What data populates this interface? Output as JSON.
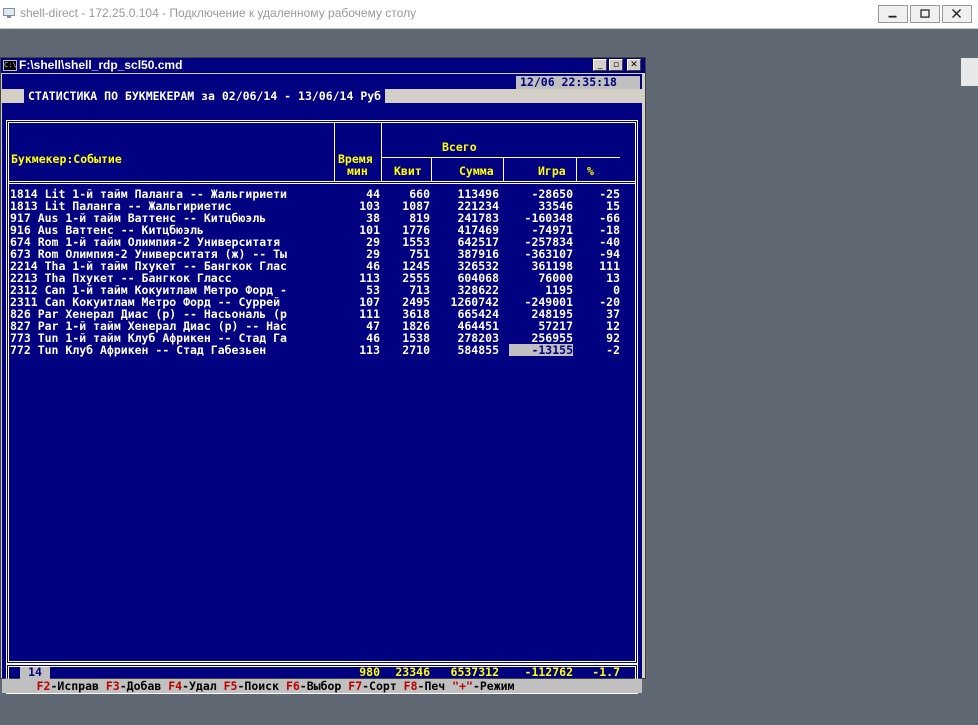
{
  "rdp_window": {
    "title": "shell-direct - 172.25.0.104 - Подключение к удаленному рабочему столу"
  },
  "console_window": {
    "title": "F:\\shell\\shell_rdp_scl50.cmd",
    "icon_text": "C:\\"
  },
  "screen": {
    "datetime": "12/06  22:35:18",
    "title": "СТАТИСТИКА ПО БУКМЕКЕРАМ за 02/06/14 - 13/06/14 Руб",
    "headers": {
      "event": "Букмекер:Событие",
      "time_line1": "Время",
      "time_line2": "мин",
      "total": "Всего",
      "kvit": "Квит",
      "summa": "Сумма",
      "igra": "Игра",
      "pct": "%"
    },
    "rows": [
      {
        "event": "1814 Lit 1-й тайм Паланга -- Жальгириети",
        "time": "44",
        "kvit": "660",
        "summa": "113496",
        "igra": "-28650",
        "pct": "-25"
      },
      {
        "event": "1813 Lit Паланга -- Жальгириетис",
        "time": "103",
        "kvit": "1087",
        "summa": "221234",
        "igra": "33546",
        "pct": "15"
      },
      {
        "event": "917 Aus 1-й тайм Ваттенс -- Китцбюэль",
        "time": "38",
        "kvit": "819",
        "summa": "241783",
        "igra": "-160348",
        "pct": "-66"
      },
      {
        "event": "916 Aus Ваттенс -- Китцбюэль",
        "time": "101",
        "kvit": "1776",
        "summa": "417469",
        "igra": "-74971",
        "pct": "-18"
      },
      {
        "event": "674 Rom 1-й тайм Олимпия-2 Университатя",
        "time": "29",
        "kvit": "1553",
        "summa": "642517",
        "igra": "-257834",
        "pct": "-40"
      },
      {
        "event": "673 Rom Олимпия-2 Университатя (ж) -- Ты",
        "time": "29",
        "kvit": "751",
        "summa": "387916",
        "igra": "-363107",
        "pct": "-94"
      },
      {
        "event": "2214 Tha 1-й тайм Пхукет -- Бангкок Глас",
        "time": "46",
        "kvit": "1245",
        "summa": "326532",
        "igra": "361198",
        "pct": "111"
      },
      {
        "event": "2213 Tha Пхукет -- Бангкок Гласс",
        "time": "113",
        "kvit": "2555",
        "summa": "604068",
        "igra": "76000",
        "pct": "13"
      },
      {
        "event": "2312 Can 1-й тайм Кокуитлам Метро Форд -",
        "time": "53",
        "kvit": "713",
        "summa": "328622",
        "igra": "1195",
        "pct": "0"
      },
      {
        "event": "2311 Can Кокуитлам Метро Форд -- Суррей",
        "time": "107",
        "kvit": "2495",
        "summa": "1260742",
        "igra": "-249001",
        "pct": "-20"
      },
      {
        "event": "826 Par Хенерал Диас (р) -- Насьональ (р",
        "time": "111",
        "kvit": "3618",
        "summa": "665424",
        "igra": "248195",
        "pct": "37"
      },
      {
        "event": "827 Par 1-й тайм Хенерал Диас (р) -- Нас",
        "time": "47",
        "kvit": "1826",
        "summa": "464451",
        "igra": "57217",
        "pct": "12"
      },
      {
        "event": "773 Tun 1-й тайм Клуб Африкен -- Стад Га",
        "time": "46",
        "kvit": "1538",
        "summa": "278203",
        "igra": "256955",
        "pct": "92"
      },
      {
        "event": "772 Tun Клуб Африкен -- Стад Габезьен",
        "time": "113",
        "kvit": "2710",
        "summa": "584855",
        "igra": "-13155",
        "pct": "-2"
      }
    ],
    "totals": {
      "time": "980",
      "kvit": "23346",
      "summa": "6537312",
      "igra": "-112762",
      "pct": "-1.7"
    },
    "record_count": "14",
    "fkeys": [
      {
        "key": "F2",
        "label": "-Исправ"
      },
      {
        "key": "F3",
        "label": "-Добав"
      },
      {
        "key": "F4",
        "label": "-Удал"
      },
      {
        "key": "F5",
        "label": "-Поиск"
      },
      {
        "key": "F6",
        "label": "-Выбор"
      },
      {
        "key": "F7",
        "label": "-Сорт"
      },
      {
        "key": "F8",
        "label": "-Печ"
      },
      {
        "key": "\"+\"",
        "label": "-Режим"
      }
    ]
  }
}
